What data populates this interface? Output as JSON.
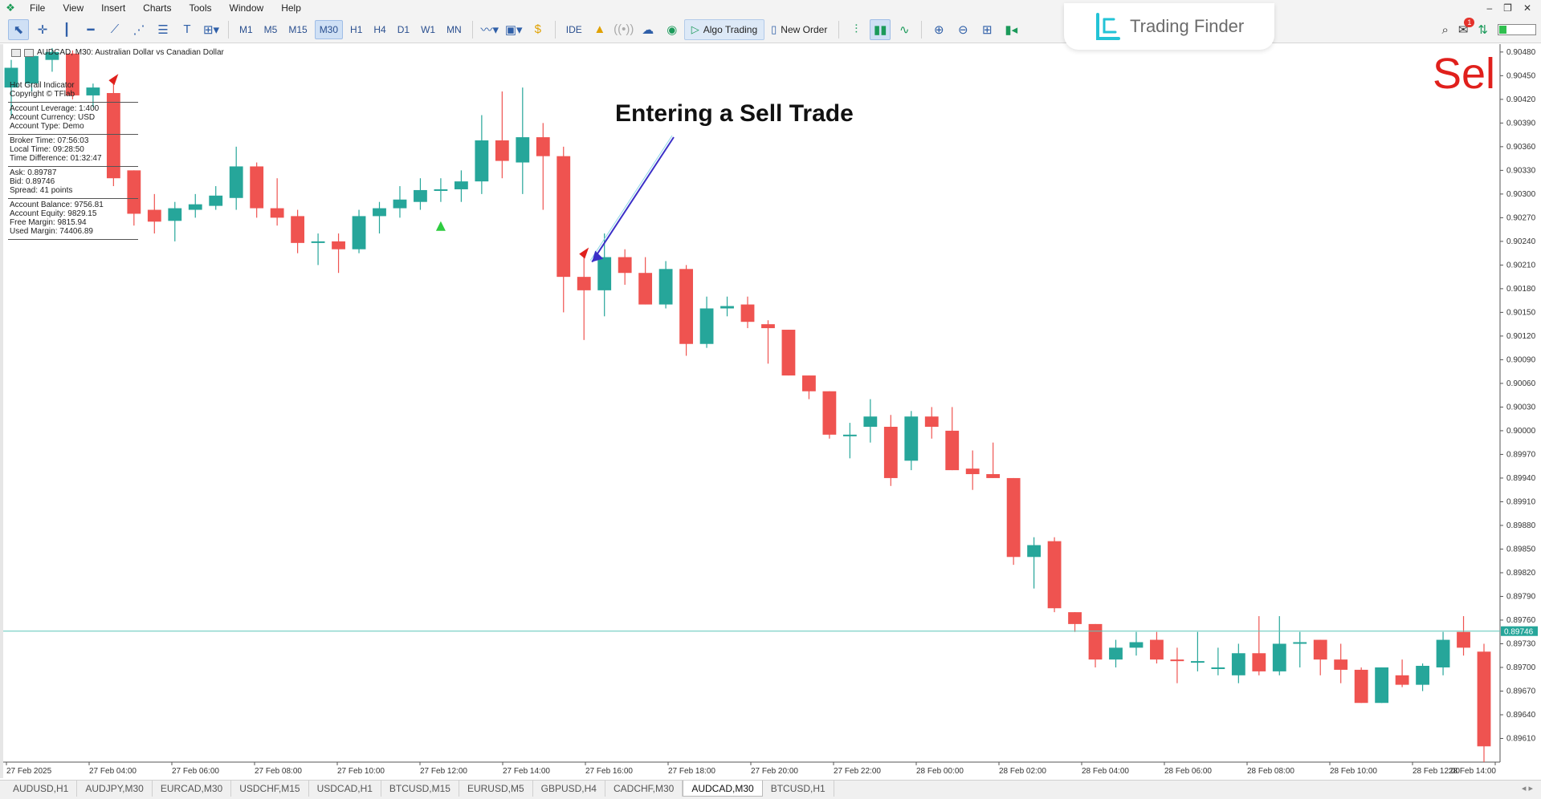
{
  "menu": {
    "items": [
      "File",
      "View",
      "Insert",
      "Charts",
      "Tools",
      "Window",
      "Help"
    ]
  },
  "toolbar": {
    "timeframes": [
      "M1",
      "M5",
      "M15",
      "M30",
      "H1",
      "H4",
      "D1",
      "W1",
      "MN"
    ],
    "active_timeframe": "M30",
    "ide_label": "IDE",
    "algo_label": "Algo Trading",
    "new_order_label": "New Order"
  },
  "branding": {
    "name": "Trading Finder"
  },
  "notification_count": "1",
  "chart": {
    "title": "AUDCAD, M30:  Australian Dollar vs Canadian Dollar",
    "bid_label": "0.89746",
    "annotation": "Entering a Sell Trade",
    "signal_label": "Sel",
    "colors": {
      "bull": "#26a69a",
      "bear": "#ef5350",
      "bid_line": "#5cc6b8",
      "bid_tag": "#26a69a"
    }
  },
  "info_panel": {
    "header": [
      "Hot Grail Indicator",
      "Copyright © TFlab"
    ],
    "account": [
      "Account Leverage: 1:400",
      "Account Currency: USD",
      "Account Type: Demo"
    ],
    "time": [
      "Broker Time: 07:56:03",
      "Local Time: 09:28:50",
      "Time Difference: 01:32:47"
    ],
    "prices": [
      "Ask: 0.89787",
      "Bid: 0.89746",
      "Spread: 41 points"
    ],
    "balance": [
      "Account Balance: 9756.81",
      "Account Equity: 9829.15",
      "Free Margin: 9815.94",
      "Used Margin: 74406.89"
    ]
  },
  "chart_data": {
    "type": "candlestick",
    "symbol": "AUDCAD",
    "timeframe": "M30",
    "ylim": [
      0.8958,
      0.9049
    ],
    "y_ticks": [
      "0.90480",
      "0.90450",
      "0.90420",
      "0.90390",
      "0.90360",
      "0.90330",
      "0.90300",
      "0.90270",
      "0.90240",
      "0.90210",
      "0.90180",
      "0.90150",
      "0.90120",
      "0.90090",
      "0.90060",
      "0.90030",
      "0.90000",
      "0.89970",
      "0.89940",
      "0.89910",
      "0.89880",
      "0.89850",
      "0.89820",
      "0.89790",
      "0.89760",
      "0.89730",
      "0.89700",
      "0.89670",
      "0.89640",
      "0.89610"
    ],
    "x_labels": [
      "27 Feb 2025",
      "27 Feb 04:00",
      "27 Feb 06:00",
      "27 Feb 08:00",
      "27 Feb 10:00",
      "27 Feb 12:00",
      "27 Feb 14:00",
      "27 Feb 16:00",
      "27 Feb 18:00",
      "27 Feb 20:00",
      "27 Feb 22:00",
      "28 Feb 00:00",
      "28 Feb 02:00",
      "28 Feb 04:00",
      "28 Feb 06:00",
      "28 Feb 08:00",
      "28 Feb 10:00",
      "28 Feb 12:00",
      "28 Feb 14:00"
    ],
    "bid": 0.89746,
    "candles": [
      [
        0.90435,
        0.9047,
        0.904,
        0.9046
      ],
      [
        0.9044,
        0.9048,
        0.9043,
        0.90475
      ],
      [
        0.9047,
        0.90485,
        0.90455,
        0.9048
      ],
      [
        0.90478,
        0.90482,
        0.9042,
        0.90425
      ],
      [
        0.90425,
        0.9044,
        0.9041,
        0.90435
      ],
      [
        0.90428,
        0.9044,
        0.9031,
        0.9032
      ],
      [
        0.9033,
        0.9033,
        0.9026,
        0.90275
      ],
      [
        0.9028,
        0.903,
        0.9025,
        0.90265
      ],
      [
        0.90266,
        0.9029,
        0.9024,
        0.90282
      ],
      [
        0.9028,
        0.903,
        0.9027,
        0.90287
      ],
      [
        0.90285,
        0.9031,
        0.9028,
        0.90298
      ],
      [
        0.90295,
        0.9036,
        0.9028,
        0.90335
      ],
      [
        0.90335,
        0.9034,
        0.9027,
        0.90282
      ],
      [
        0.90282,
        0.9032,
        0.9026,
        0.9027
      ],
      [
        0.90272,
        0.9028,
        0.90225,
        0.90238
      ],
      [
        0.90238,
        0.9025,
        0.9021,
        0.9024
      ],
      [
        0.9024,
        0.9025,
        0.902,
        0.9023
      ],
      [
        0.9023,
        0.9028,
        0.90225,
        0.90272
      ],
      [
        0.90272,
        0.9029,
        0.9025,
        0.90282
      ],
      [
        0.90282,
        0.9031,
        0.9027,
        0.90293
      ],
      [
        0.9029,
        0.9032,
        0.9028,
        0.90305
      ],
      [
        0.90305,
        0.9032,
        0.9029,
        0.90306
      ],
      [
        0.90306,
        0.9033,
        0.9029,
        0.90316
      ],
      [
        0.90316,
        0.904,
        0.903,
        0.90368
      ],
      [
        0.90368,
        0.9043,
        0.9032,
        0.90342
      ],
      [
        0.9034,
        0.90435,
        0.903,
        0.90372
      ],
      [
        0.90372,
        0.9039,
        0.9028,
        0.90348
      ],
      [
        0.90348,
        0.9036,
        0.9015,
        0.90195
      ],
      [
        0.90195,
        0.9022,
        0.90115,
        0.90178
      ],
      [
        0.90178,
        0.9025,
        0.90145,
        0.9022
      ],
      [
        0.9022,
        0.9023,
        0.90185,
        0.902
      ],
      [
        0.902,
        0.9022,
        0.9016,
        0.9016
      ],
      [
        0.9016,
        0.90215,
        0.90155,
        0.90205
      ],
      [
        0.90205,
        0.9021,
        0.90095,
        0.9011
      ],
      [
        0.9011,
        0.9017,
        0.90105,
        0.90155
      ],
      [
        0.90155,
        0.9017,
        0.90145,
        0.90158
      ],
      [
        0.9016,
        0.9017,
        0.9013,
        0.90138
      ],
      [
        0.90135,
        0.9014,
        0.90085,
        0.9013
      ],
      [
        0.90128,
        0.90128,
        0.9007,
        0.9007
      ],
      [
        0.9007,
        0.9007,
        0.9004,
        0.9005
      ],
      [
        0.9005,
        0.9005,
        0.8999,
        0.89995
      ],
      [
        0.89995,
        0.9001,
        0.89965,
        0.89995
      ],
      [
        0.90005,
        0.9004,
        0.89985,
        0.90018
      ],
      [
        0.90005,
        0.9002,
        0.8993,
        0.8994
      ],
      [
        0.89962,
        0.90025,
        0.8995,
        0.90018
      ],
      [
        0.90018,
        0.9003,
        0.8999,
        0.90005
      ],
      [
        0.9,
        0.9003,
        0.8995,
        0.8995
      ],
      [
        0.89952,
        0.89975,
        0.89925,
        0.89945
      ],
      [
        0.89945,
        0.89985,
        0.8994,
        0.8994
      ],
      [
        0.8994,
        0.8994,
        0.8983,
        0.8984
      ],
      [
        0.8984,
        0.89865,
        0.898,
        0.89855
      ],
      [
        0.8986,
        0.89865,
        0.8977,
        0.89775
      ],
      [
        0.8977,
        0.8977,
        0.89745,
        0.89755
      ],
      [
        0.89755,
        0.89755,
        0.897,
        0.8971
      ],
      [
        0.8971,
        0.89735,
        0.897,
        0.89725
      ],
      [
        0.89725,
        0.89745,
        0.89715,
        0.89732
      ],
      [
        0.89735,
        0.89745,
        0.89705,
        0.8971
      ],
      [
        0.8971,
        0.89725,
        0.8968,
        0.89708
      ],
      [
        0.89706,
        0.89745,
        0.89695,
        0.89708
      ],
      [
        0.897,
        0.89725,
        0.8969,
        0.897
      ],
      [
        0.8969,
        0.8973,
        0.8968,
        0.89718
      ],
      [
        0.89718,
        0.89765,
        0.8969,
        0.89695
      ],
      [
        0.89695,
        0.89765,
        0.8969,
        0.8973
      ],
      [
        0.8973,
        0.89745,
        0.897,
        0.89732
      ],
      [
        0.89735,
        0.89735,
        0.8969,
        0.8971
      ],
      [
        0.8971,
        0.8973,
        0.8968,
        0.89697
      ],
      [
        0.89697,
        0.897,
        0.89655,
        0.89655
      ],
      [
        0.89655,
        0.897,
        0.89655,
        0.897
      ],
      [
        0.8969,
        0.8971,
        0.89675,
        0.89678
      ],
      [
        0.89678,
        0.89705,
        0.8967,
        0.89702
      ],
      [
        0.897,
        0.89745,
        0.8969,
        0.89735
      ],
      [
        0.89745,
        0.89765,
        0.89715,
        0.89725
      ],
      [
        0.8972,
        0.8973,
        0.8958,
        0.896
      ]
    ],
    "buy_arrow_index": 21,
    "sell_arrow_indices": [
      5,
      28
    ]
  },
  "tabs": {
    "items": [
      "AUDUSD,H1",
      "AUDJPY,M30",
      "EURCAD,M30",
      "USDCHF,M15",
      "USDCAD,H1",
      "BTCUSD,M15",
      "EURUSD,M5",
      "GBPUSD,H4",
      "CADCHF,M30",
      "AUDCAD,M30",
      "BTCUSD,H1"
    ],
    "active": "AUDCAD,M30"
  }
}
